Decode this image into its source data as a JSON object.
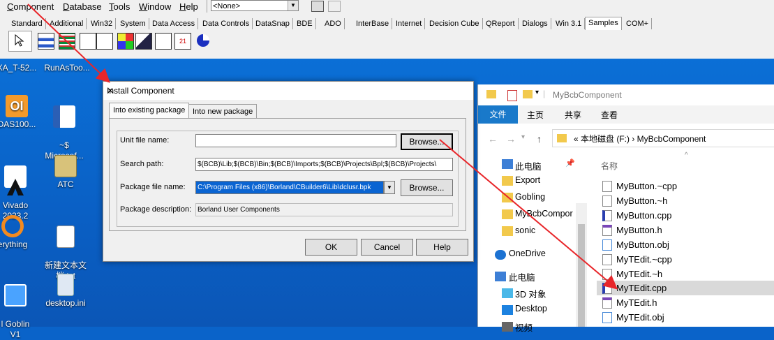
{
  "ide": {
    "menu": [
      {
        "label": "Component"
      },
      {
        "label": "Database"
      },
      {
        "label": "Tools"
      },
      {
        "label": "Window"
      },
      {
        "label": "Help"
      }
    ],
    "combo_value": "<None>",
    "palette_tabs": [
      {
        "label": "Standard"
      },
      {
        "label": "Additional"
      },
      {
        "label": "Win32"
      },
      {
        "label": "System"
      },
      {
        "label": "Data Access"
      },
      {
        "label": "Data Controls"
      },
      {
        "label": "DataSnap"
      },
      {
        "label": "BDE"
      },
      {
        "label": "ADO"
      },
      {
        "label": "InterBase"
      },
      {
        "label": "Internet"
      },
      {
        "label": "Decision Cube"
      },
      {
        "label": "QReport"
      },
      {
        "label": "Dialogs"
      },
      {
        "label": "Win 3.1"
      },
      {
        "label": "Samples"
      },
      {
        "label": "COM+"
      }
    ],
    "active_tab": "Samples"
  },
  "desktop": {
    "icons": [
      {
        "label": "XA_T-52..."
      },
      {
        "label": "RunAsToo..."
      },
      {
        "label": "DAS100..."
      },
      {
        "label": "~$\nMicrosof..."
      },
      {
        "label": "Vivado\n2023.2"
      },
      {
        "label": "ATC"
      },
      {
        "label": "erything"
      },
      {
        "label": "新建文本文\n档.txt"
      },
      {
        "label": "l Goblin\nV1"
      },
      {
        "label": "desktop.ini"
      }
    ]
  },
  "dialog": {
    "title": "Install Component",
    "tabs": [
      {
        "label": "Into existing package"
      },
      {
        "label": "Into new package"
      }
    ],
    "unit_label": "Unit file name:",
    "unit_value": "",
    "search_label": "Search path:",
    "search_value": "$(BCB)\\Lib;$(BCB)\\Bin;$(BCB)\\Imports;$(BCB)\\Projects\\Bpl;$(BCB)\\Projects\\",
    "package_label": "Package file name:",
    "package_value": "C:\\Program Files (x86)\\Borland\\CBuilder6\\Lib\\dclusr.bpk",
    "desc_label": "Package description:",
    "desc_value": "Borland User Components",
    "browse1": "Browse...",
    "browse2": "Browse...",
    "ok": "OK",
    "cancel": "Cancel",
    "help": "Help",
    "close": "✕"
  },
  "explorer": {
    "title": "MyBcbComponent",
    "ribbon": [
      {
        "label": "主页"
      },
      {
        "label": "共享"
      },
      {
        "label": "查看"
      }
    ],
    "ribbon_file": "文件",
    "address": "«  本地磁盘 (F:)  ›  MyBcbComponent",
    "column_name": "名称",
    "nav": [
      {
        "label": "此电脑"
      },
      {
        "label": "Export"
      },
      {
        "label": "Gobling"
      },
      {
        "label": "MyBcbCompor"
      },
      {
        "label": "sonic"
      },
      {
        "label": "OneDrive"
      },
      {
        "label": "此电脑"
      },
      {
        "label": "3D 对象"
      },
      {
        "label": "Desktop"
      },
      {
        "label": "视频"
      }
    ],
    "files": [
      {
        "label": "MyButton.~cpp"
      },
      {
        "label": "MyButton.~h"
      },
      {
        "label": "MyButton.cpp"
      },
      {
        "label": "MyButton.h"
      },
      {
        "label": "MyButton.obj"
      },
      {
        "label": "MyTEdit.~cpp"
      },
      {
        "label": "MyTEdit.~h"
      },
      {
        "label": "MyTEdit.cpp"
      },
      {
        "label": "MyTEdit.h"
      },
      {
        "label": "MyTEdit.obj"
      }
    ],
    "selected_file": "MyTEdit.cpp"
  }
}
